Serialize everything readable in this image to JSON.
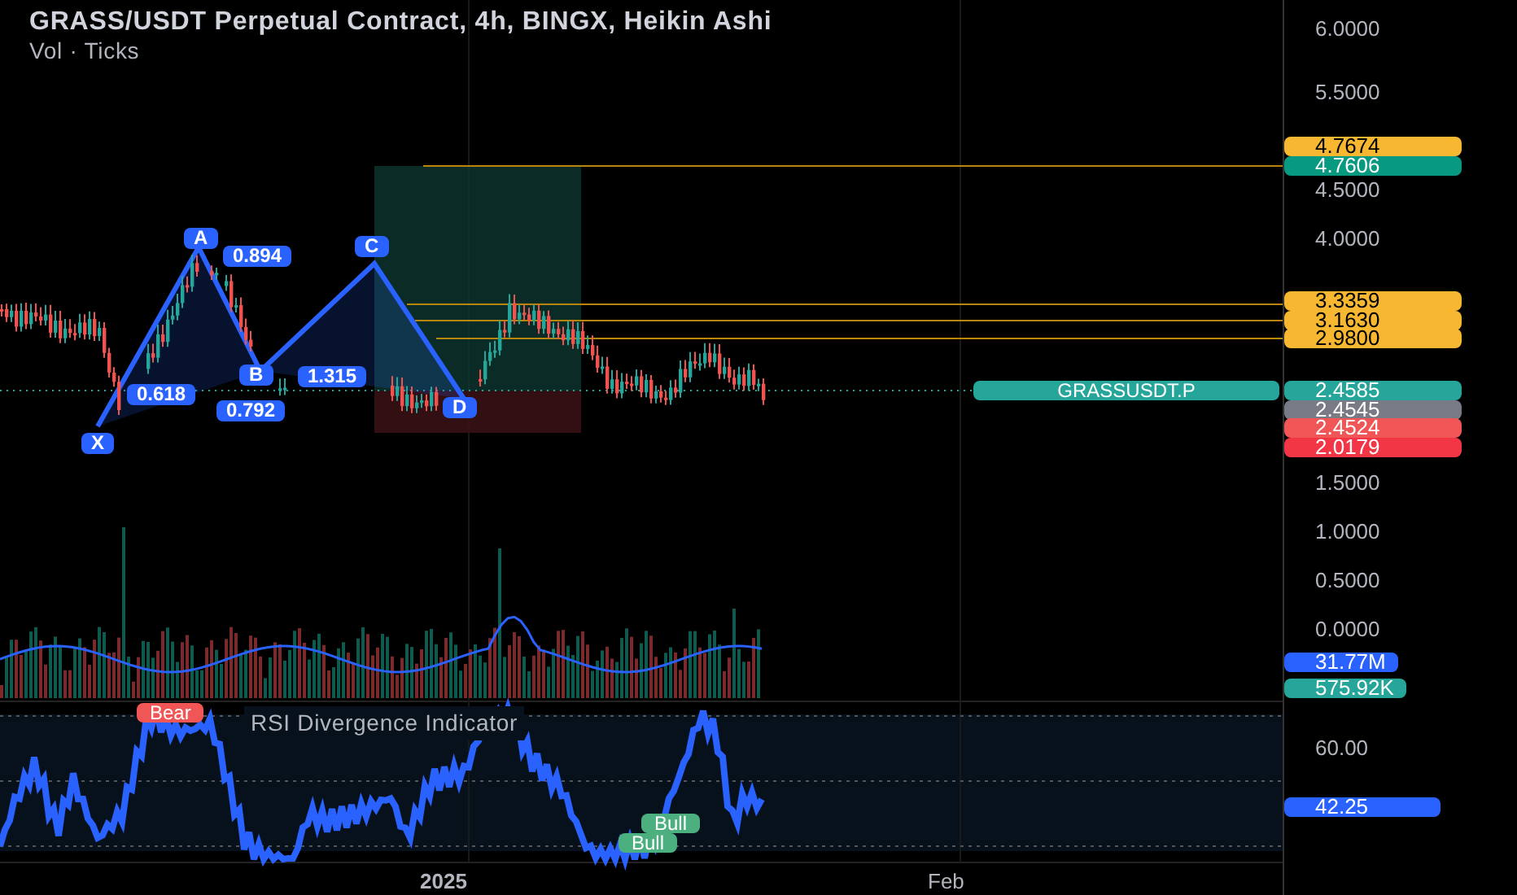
{
  "header": {
    "title": "GRASS/USDT Perpetual Contract, 4h, BINGX, Heikin Ashi",
    "subtitle": "Vol · Ticks"
  },
  "price_axis": {
    "ticks": [
      "6.0000",
      "5.5000",
      "4.5000",
      "4.0000",
      "1.5000",
      "1.0000",
      "0.5000",
      "0.0000"
    ]
  },
  "price_badges": [
    {
      "text": "4.7674",
      "color": "#f7b731"
    },
    {
      "text": "4.7606",
      "color": "#089981"
    },
    {
      "text": "3.3359",
      "color": "#f7b731"
    },
    {
      "text": "3.1630",
      "color": "#f7b731"
    },
    {
      "text": "2.9800",
      "color": "#f7b731"
    },
    {
      "text": "2.4585",
      "color": "#26a69a"
    },
    {
      "text": "2.4545",
      "color": "#787b86"
    },
    {
      "text": "2.4524",
      "color": "#f05656"
    },
    {
      "text": "2.0179",
      "color": "#f23645"
    }
  ],
  "symbol_label": "GRASSUSDT.P",
  "pattern_labels": [
    "X",
    "A",
    "B",
    "C",
    "D",
    "0.894",
    "0.618",
    "0.792",
    "1.315"
  ],
  "volume_badges": [
    {
      "text": "31.77M",
      "color": "#2962ff"
    },
    {
      "text": "575.92K",
      "color": "#26a69a"
    }
  ],
  "rsi": {
    "title": "RSI Divergence Indicator",
    "ticks": [
      "60.00"
    ],
    "value": "42.25",
    "signals": [
      {
        "text": "Bear",
        "kind": "bear"
      },
      {
        "text": "Bull",
        "kind": "bull"
      },
      {
        "text": "Bull",
        "kind": "bull"
      }
    ]
  },
  "time_axis": [
    "2025",
    "Feb"
  ]
}
